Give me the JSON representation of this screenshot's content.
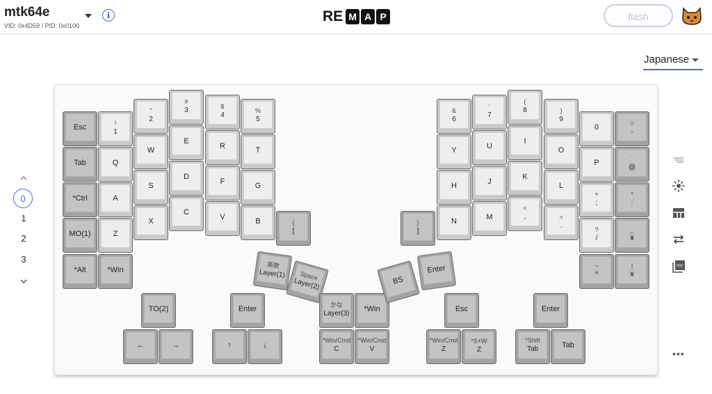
{
  "header": {
    "keyboard_name": "mtk64e",
    "vid_pid": "VID: 0x4D59 / PID: 0x0100",
    "logo_plain": "RE",
    "logo_boxed": [
      "M",
      "A",
      "P"
    ],
    "flash_label": "flash"
  },
  "layout_select": {
    "value": "Japanese"
  },
  "layers": {
    "items": [
      "0",
      "1",
      "2",
      "3"
    ],
    "selected": "0"
  },
  "right_toolbar": {
    "icons": [
      "lines-icon",
      "lighting-icon",
      "layout-icon",
      "swap-icon",
      "pdf-icon"
    ],
    "more": "•••"
  },
  "keys": [
    {
      "id": "esc",
      "lines": [
        "Esc"
      ],
      "dark": true
    },
    {
      "id": "k1",
      "lines": [
        "!",
        "1"
      ],
      "dark": false
    },
    {
      "id": "k2",
      "lines": [
        "\"",
        "2"
      ],
      "dark": false
    },
    {
      "id": "k3",
      "lines": [
        "#",
        "3"
      ],
      "dark": false
    },
    {
      "id": "k4",
      "lines": [
        "$",
        "4"
      ],
      "dark": false
    },
    {
      "id": "k5",
      "lines": [
        "%",
        "5"
      ],
      "dark": false
    },
    {
      "id": "tab",
      "lines": [
        "Tab"
      ],
      "dark": true
    },
    {
      "id": "q",
      "lines": [
        "Q"
      ],
      "dark": false
    },
    {
      "id": "w",
      "lines": [
        "W"
      ],
      "dark": false
    },
    {
      "id": "e",
      "lines": [
        "E"
      ],
      "dark": false
    },
    {
      "id": "r",
      "lines": [
        "R"
      ],
      "dark": false
    },
    {
      "id": "t",
      "lines": [
        "T"
      ],
      "dark": false
    },
    {
      "id": "ctrl",
      "lines": [
        "*Ctrl"
      ],
      "dark": true
    },
    {
      "id": "a",
      "lines": [
        "A"
      ],
      "dark": false
    },
    {
      "id": "s",
      "lines": [
        "S"
      ],
      "dark": false
    },
    {
      "id": "d",
      "lines": [
        "D"
      ],
      "dark": false
    },
    {
      "id": "f",
      "lines": [
        "F"
      ],
      "dark": false
    },
    {
      "id": "g",
      "lines": [
        "G"
      ],
      "dark": false
    },
    {
      "id": "mo1",
      "lines": [
        "MO(1)"
      ],
      "dark": true
    },
    {
      "id": "z",
      "lines": [
        "Z"
      ],
      "dark": false
    },
    {
      "id": "x",
      "lines": [
        "X"
      ],
      "dark": false
    },
    {
      "id": "c",
      "lines": [
        "C"
      ],
      "dark": false
    },
    {
      "id": "v",
      "lines": [
        "V"
      ],
      "dark": false
    },
    {
      "id": "b",
      "lines": [
        "B"
      ],
      "dark": false
    },
    {
      "id": "lbrace",
      "lines": [
        "{",
        "["
      ],
      "dark": true
    },
    {
      "id": "alt",
      "lines": [
        "*Alt"
      ],
      "dark": true
    },
    {
      "id": "win",
      "lines": [
        "*Win"
      ],
      "dark": true
    },
    {
      "id": "eisu",
      "lines": [
        "英数",
        "Layer(1)"
      ],
      "dark": true
    },
    {
      "id": "space",
      "lines": [
        "Space",
        "Layer(2)"
      ],
      "dark": true
    },
    {
      "id": "kana",
      "lines": [
        "かな",
        "Layer(3)"
      ],
      "dark": true
    },
    {
      "id": "win2",
      "lines": [
        "*Win"
      ],
      "dark": true
    },
    {
      "id": "bs",
      "lines": [
        "BS"
      ],
      "dark": true
    },
    {
      "id": "enter1",
      "lines": [
        "Enter"
      ],
      "dark": true
    },
    {
      "id": "to2",
      "lines": [
        "TO(2)"
      ],
      "dark": true
    },
    {
      "id": "enter2",
      "lines": [
        "Enter"
      ],
      "dark": true
    },
    {
      "id": "esc2",
      "lines": [
        "Esc"
      ],
      "dark": true
    },
    {
      "id": "enter3",
      "lines": [
        "Enter"
      ],
      "dark": true
    },
    {
      "id": "left",
      "lines": [
        "←"
      ],
      "dark": true
    },
    {
      "id": "right",
      "lines": [
        "→"
      ],
      "dark": true
    },
    {
      "id": "up",
      "lines": [
        "↑"
      ],
      "dark": true
    },
    {
      "id": "down",
      "lines": [
        "↓"
      ],
      "dark": true
    },
    {
      "id": "wc",
      "lines": [
        "*Win/Cmd",
        "C"
      ],
      "dark": true
    },
    {
      "id": "wv",
      "lines": [
        "*Win/Cmd",
        "V"
      ],
      "dark": true
    },
    {
      "id": "wz",
      "lines": [
        "*Win/Cmd",
        "Z"
      ],
      "dark": true
    },
    {
      "id": "swz",
      "lines": [
        "*S+W",
        "Z"
      ],
      "dark": true
    },
    {
      "id": "stab",
      "lines": [
        "*Shift",
        "Tab"
      ],
      "dark": true
    },
    {
      "id": "tab2",
      "lines": [
        "Tab"
      ],
      "dark": true
    },
    {
      "id": "k6",
      "lines": [
        "&",
        "6"
      ],
      "dark": false
    },
    {
      "id": "k7",
      "lines": [
        "'",
        "7"
      ],
      "dark": false
    },
    {
      "id": "k8",
      "lines": [
        "(",
        "8"
      ],
      "dark": false
    },
    {
      "id": "k9",
      "lines": [
        ")",
        "9"
      ],
      "dark": false
    },
    {
      "id": "k0",
      "lines": [
        "0"
      ],
      "dark": false
    },
    {
      "id": "minus",
      "lines": [
        "=",
        "-"
      ],
      "dark": true
    },
    {
      "id": "y",
      "lines": [
        "Y"
      ],
      "dark": false
    },
    {
      "id": "u",
      "lines": [
        "U"
      ],
      "dark": false
    },
    {
      "id": "i",
      "lines": [
        "I"
      ],
      "dark": false
    },
    {
      "id": "o",
      "lines": [
        "O"
      ],
      "dark": false
    },
    {
      "id": "p",
      "lines": [
        "P"
      ],
      "dark": false
    },
    {
      "id": "at",
      "lines": [
        "`",
        "@"
      ],
      "dark": true
    },
    {
      "id": "h",
      "lines": [
        "H"
      ],
      "dark": false
    },
    {
      "id": "j",
      "lines": [
        "J"
      ],
      "dark": false
    },
    {
      "id": "k",
      "lines": [
        "K"
      ],
      "dark": false
    },
    {
      "id": "l",
      "lines": [
        "L"
      ],
      "dark": false
    },
    {
      "id": "semi",
      "lines": [
        "+",
        ";"
      ],
      "dark": false
    },
    {
      "id": "colon",
      "lines": [
        "*",
        ":"
      ],
      "dark": true
    },
    {
      "id": "rbrace",
      "lines": [
        "}",
        "]"
      ],
      "dark": true
    },
    {
      "id": "n",
      "lines": [
        "N"
      ],
      "dark": false
    },
    {
      "id": "m",
      "lines": [
        "M"
      ],
      "dark": false
    },
    {
      "id": "comma",
      "lines": [
        "<",
        ","
      ],
      "dark": false
    },
    {
      "id": "period",
      "lines": [
        ">",
        "."
      ],
      "dark": false
    },
    {
      "id": "slash",
      "lines": [
        "?",
        "/"
      ],
      "dark": false
    },
    {
      "id": "yen",
      "lines": [
        "_",
        "¥"
      ],
      "dark": true
    },
    {
      "id": "caret",
      "lines": [
        "~",
        "^"
      ],
      "dark": true
    },
    {
      "id": "yen2",
      "lines": [
        "|",
        "¥"
      ],
      "dark": true
    }
  ]
}
